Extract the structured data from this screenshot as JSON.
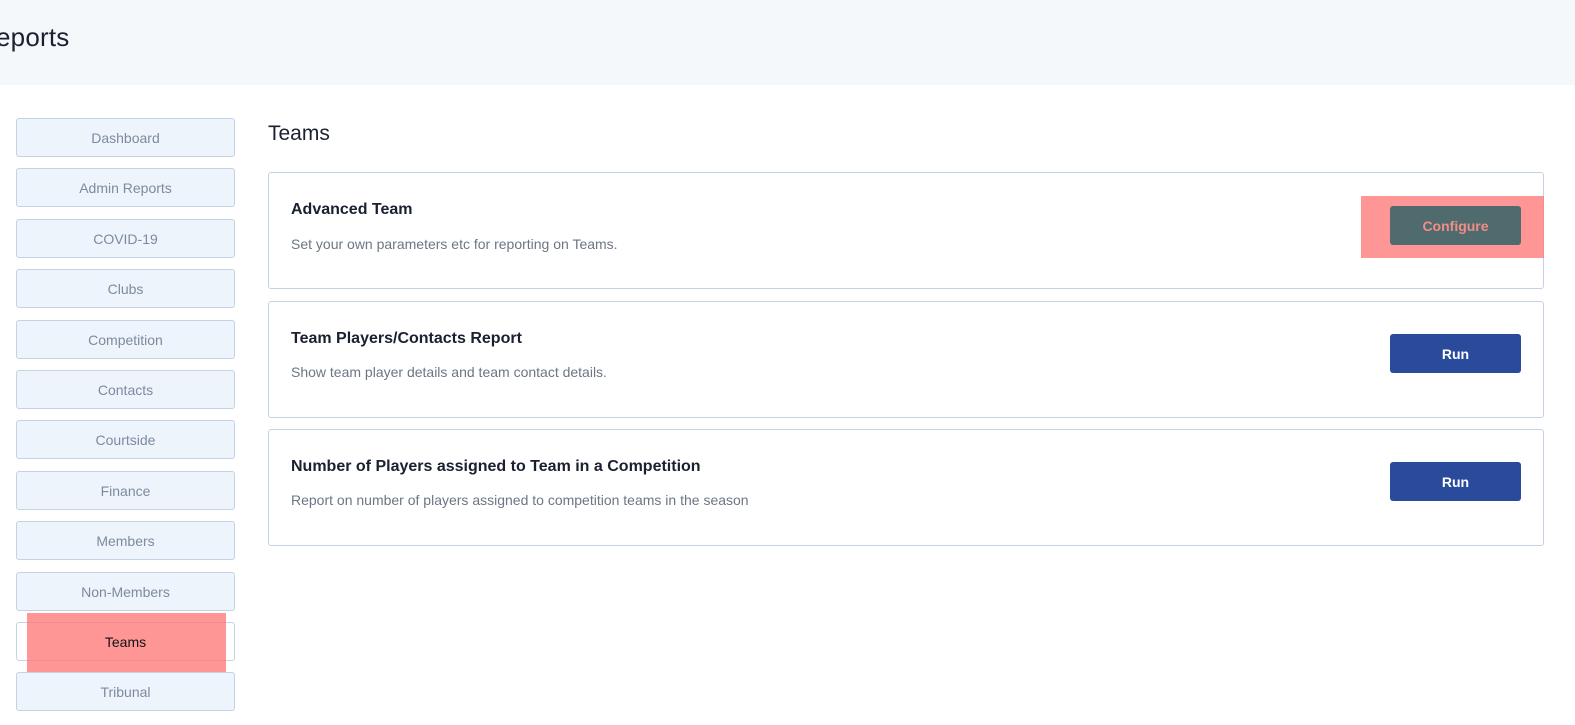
{
  "header": {
    "title": "eports"
  },
  "sidebar": {
    "items": [
      {
        "label": "Dashboard"
      },
      {
        "label": "Admin Reports"
      },
      {
        "label": "COVID-19"
      },
      {
        "label": "Clubs"
      },
      {
        "label": "Competition"
      },
      {
        "label": "Contacts"
      },
      {
        "label": "Courtside"
      },
      {
        "label": "Finance"
      },
      {
        "label": "Members"
      },
      {
        "label": "Non-Members"
      },
      {
        "label": "Teams"
      },
      {
        "label": "Tribunal"
      }
    ],
    "active": "Teams"
  },
  "main": {
    "section_title": "Teams",
    "cards": [
      {
        "title": "Advanced Team",
        "description": "Set your own parameters etc for reporting on Teams.",
        "button": "Configure"
      },
      {
        "title": "Team Players/Contacts Report",
        "description": "Show team player details and team contact details.",
        "button": "Run"
      },
      {
        "title": "Number of Players assigned to Team in a Competition",
        "description": "Report on number of players assigned to competition teams in the season",
        "button": "Run"
      }
    ]
  },
  "colors": {
    "header_bg": "#f5f8fb",
    "sidebar_item_bg": "#eef4fb",
    "button_primary": "#2a4a9b",
    "highlight": "#ff7878"
  }
}
